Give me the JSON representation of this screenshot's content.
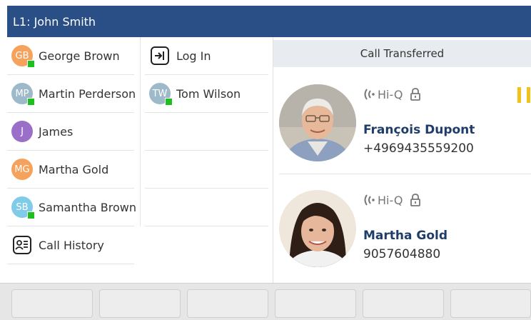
{
  "titlebar": {
    "title": "L1: John Smith"
  },
  "column1": [
    {
      "type": "contact",
      "initials": "GB",
      "label": "George Brown",
      "color": "#f5a25d",
      "presence": true
    },
    {
      "type": "contact",
      "initials": "MP",
      "label": "Martin Perderson",
      "color": "#9eb9c9",
      "presence": true
    },
    {
      "type": "contact",
      "initials": "J",
      "label": "James",
      "color": "#9b6fc9",
      "presence": false
    },
    {
      "type": "contact",
      "initials": "MG",
      "label": "Martha Gold",
      "color": "#f5a25d",
      "presence": false
    },
    {
      "type": "contact",
      "initials": "SB",
      "label": "Samantha Brown",
      "color": "#7fcbe8",
      "presence": true
    },
    {
      "type": "app",
      "icon": "call-history-icon",
      "label": "Call History"
    }
  ],
  "column2": [
    {
      "type": "app",
      "icon": "login-icon",
      "label": "Log In"
    },
    {
      "type": "contact",
      "initials": "TW",
      "label": "Tom Wilson",
      "color": "#9eb9c9",
      "presence": true
    },
    {
      "type": "empty"
    },
    {
      "type": "empty"
    },
    {
      "type": "empty"
    }
  ],
  "calls": {
    "status": "Call Transferred",
    "items": [
      {
        "codec": "Hi-Q",
        "name": "François Dupont",
        "number": "+4969435559200",
        "on_hold": true
      },
      {
        "codec": "Hi-Q",
        "name": "Martha Gold",
        "number": "9057604880",
        "on_hold": false
      }
    ]
  },
  "colors": {
    "titlebar": "#2a4e86",
    "presence": "#1fbf1f",
    "hold": "#f2c21b",
    "caller_name": "#1f3d6b"
  }
}
